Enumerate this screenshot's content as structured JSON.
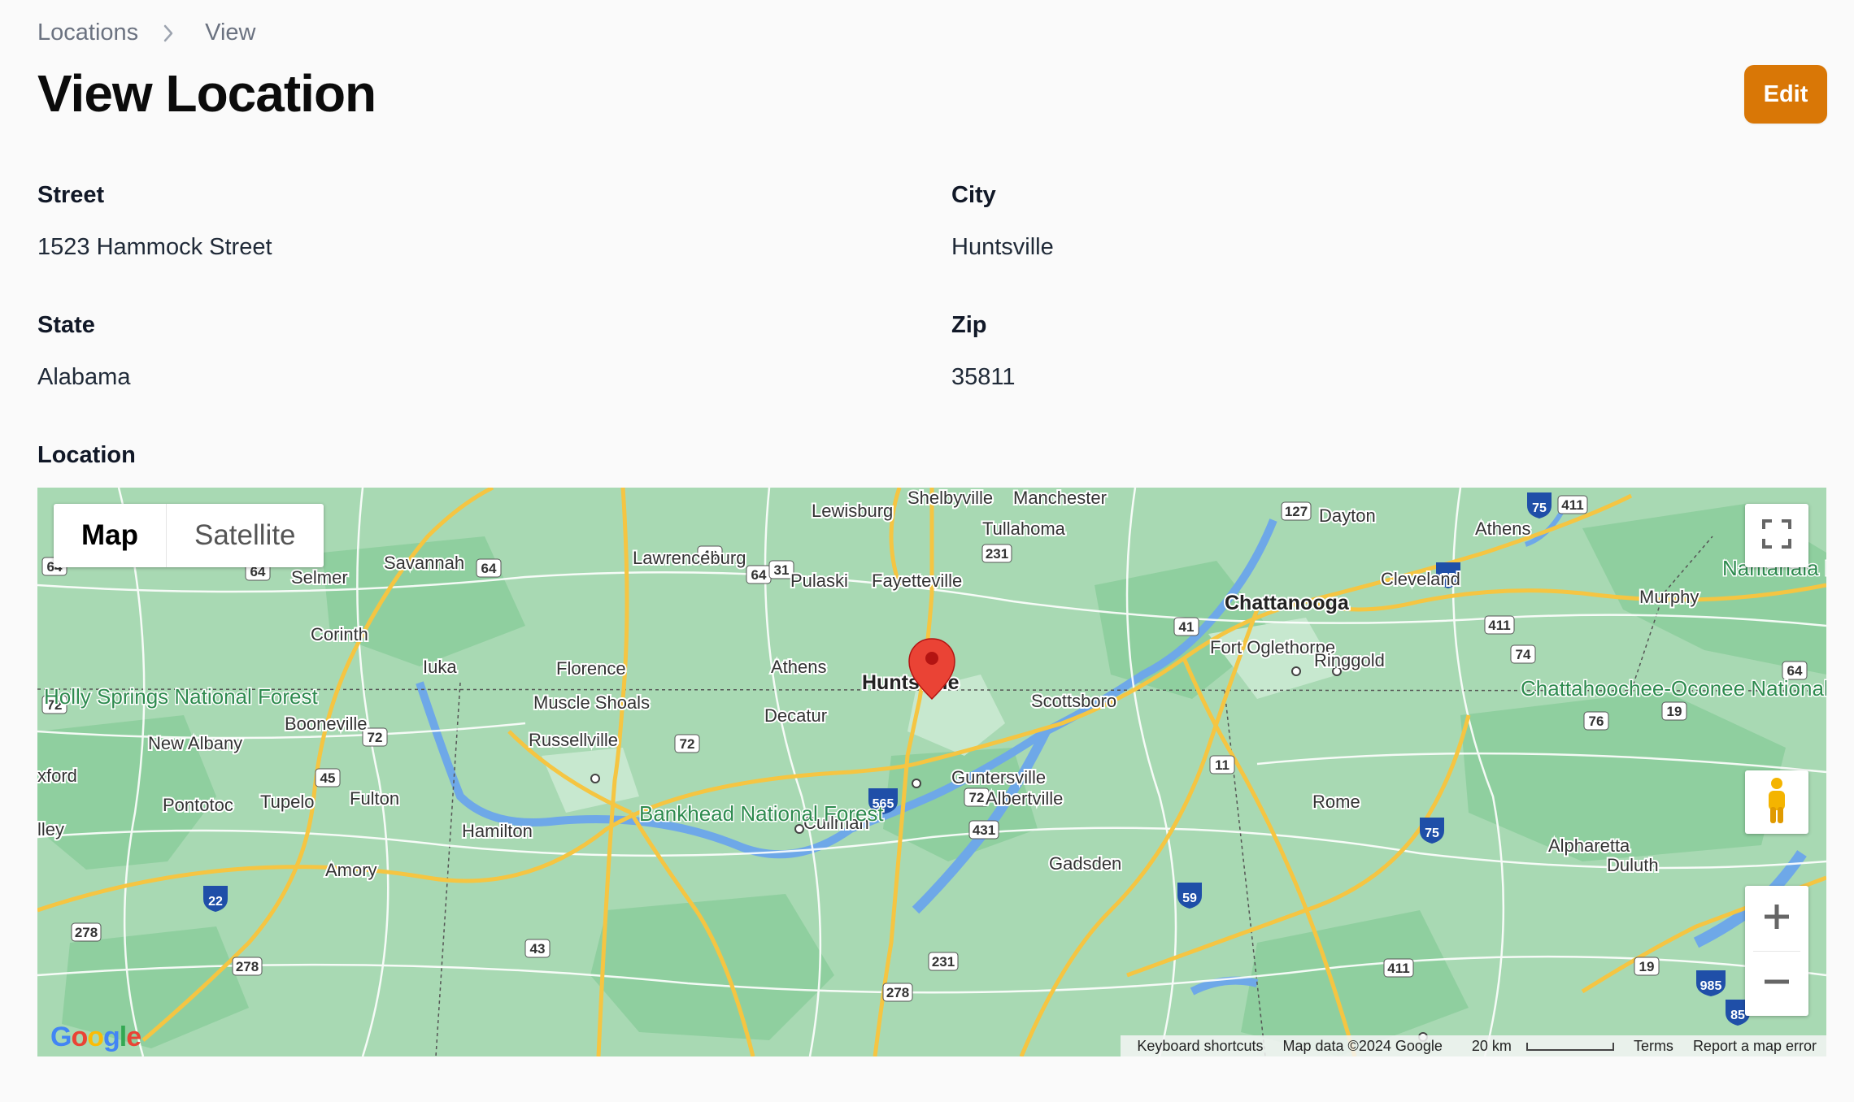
{
  "breadcrumb": {
    "items": [
      "Locations",
      "View"
    ]
  },
  "page": {
    "title": "View Location",
    "edit_label": "Edit"
  },
  "fields": {
    "street": {
      "label": "Street",
      "value": "1523 Hammock Street"
    },
    "city": {
      "label": "City",
      "value": "Huntsville"
    },
    "state": {
      "label": "State",
      "value": "Alabama"
    },
    "zip": {
      "label": "Zip",
      "value": "35811"
    },
    "location": {
      "label": "Location"
    }
  },
  "map": {
    "type_control": {
      "map": "Map",
      "satellite": "Satellite",
      "selected": "Map"
    },
    "marker_city": "Huntsville",
    "labels": {
      "lewisburg": "Lewisburg",
      "shelbyville": "Shelbyville",
      "manchester": "Manchester",
      "tullahoma": "Tullahoma",
      "dayton": "Dayton",
      "athens_tn": "Athens",
      "savannah": "Savannah",
      "lawrenceburg": "Lawrenceburg",
      "selmer": "Selmer",
      "pulaski": "Pulaski",
      "fayetteville": "Fayetteville",
      "cleveland": "Cleveland",
      "chattanooga": "Chattanooga",
      "murphy": "Murphy",
      "corinth": "Corinth",
      "fort_oglethorpe": "Fort Oglethorpe",
      "ringgold": "Ringgold",
      "iuka": "Iuka",
      "florence": "Florence",
      "athens_al": "Athens",
      "holly_springs": "Holly Springs National Forest",
      "muscle_shoals": "Muscle Shoals",
      "scottsboro": "Scottsboro",
      "decatur": "Decatur",
      "chattahoochee": "Chattahoochee-Oconee National Forests",
      "nantahala": "Nantahala National F",
      "booneville": "Booneville",
      "new_albany": "New Albany",
      "russellville": "Russellville",
      "guntersville": "Guntersville",
      "albertville": "Albertville",
      "pontotoc": "Pontotoc",
      "tupelo": "Tupelo",
      "fulton": "Fulton",
      "bankhead": "Bankhead National Forest",
      "hamilton": "Hamilton",
      "cullman": "Cullman",
      "rome": "Rome",
      "alpharetta": "Alpharetta",
      "duluth": "Duluth",
      "gadsden": "Gadsden",
      "amory": "Amory",
      "oxford": "xford",
      "valley": "lley"
    },
    "google": "Google",
    "attribution": {
      "shortcuts": "Keyboard shortcuts",
      "data": "Map data ©2024 Google",
      "scale": "20 km",
      "terms": "Terms",
      "report": "Report a map error"
    },
    "colors": {
      "land": "#a8d9b3",
      "forest": "#8fcf9f",
      "water": "#6ea8e8",
      "highway": "#f5c542",
      "road": "#ffffff",
      "marker": "#ea4335"
    }
  }
}
